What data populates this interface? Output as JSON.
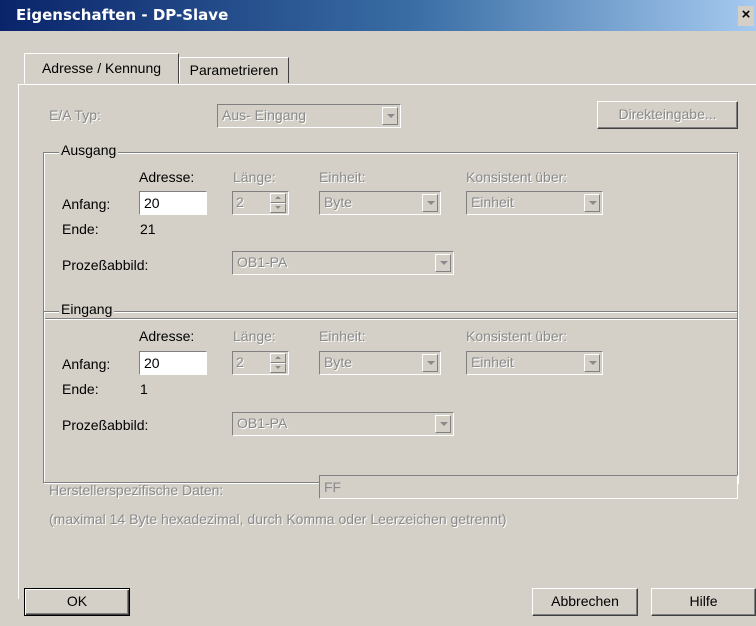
{
  "window": {
    "title": "Eigenschaften - DP-Slave",
    "close_glyph": "×"
  },
  "tabs": [
    {
      "label": "Adresse / Kennung",
      "active": true
    },
    {
      "label": "Parametrieren",
      "active": false
    }
  ],
  "ea_typ": {
    "label": "E/A Typ:",
    "value": "Aus- Eingang",
    "direct_button": "Direkteingabe..."
  },
  "ausgang": {
    "legend": "Ausgang",
    "col_adresse": "Adresse:",
    "col_laenge": "Länge:",
    "col_einheit": "Einheit:",
    "col_konsistent": "Konsistent über:",
    "anfang_label": "Anfang:",
    "anfang_value": "20",
    "laenge_value": "2",
    "einheit_value": "Byte",
    "konsistent_value": "Einheit",
    "ende_label": "Ende:",
    "ende_value": "21",
    "prozess_label": "Prozeßabbild:",
    "prozess_value": "OB1-PA"
  },
  "eingang": {
    "legend": "Eingang",
    "col_adresse": "Adresse:",
    "col_laenge": "Länge:",
    "col_einheit": "Einheit:",
    "col_konsistent": "Konsistent über:",
    "anfang_label": "Anfang:",
    "anfang_value": "20",
    "laenge_value": "2",
    "einheit_value": "Byte",
    "konsistent_value": "Einheit",
    "ende_label": "Ende:",
    "ende_value": "1",
    "prozess_label": "Prozeßabbild:",
    "prozess_value": "OB1-PA"
  },
  "hersteller": {
    "label": "Herstellerspezifische Daten:",
    "value": "FF",
    "hint": "(maximal 14 Byte hexadezimal, durch Komma oder Leerzeichen getrennt)"
  },
  "footer": {
    "ok": "OK",
    "cancel": "Abbrechen",
    "help": "Hilfe"
  }
}
